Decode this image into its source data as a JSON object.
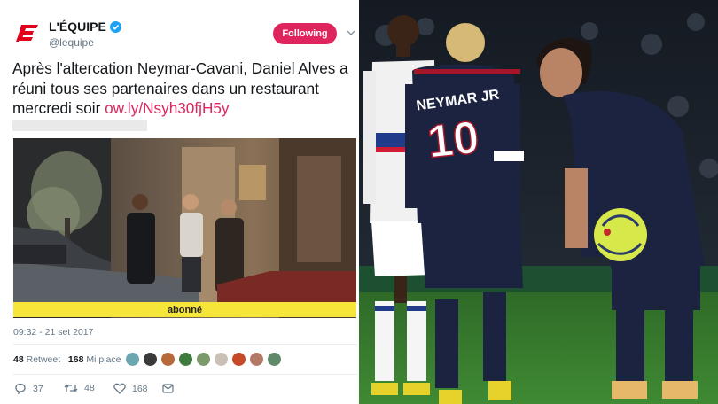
{
  "tweet": {
    "display_name": "L'ÉQUIPE",
    "handle": "@lequipe",
    "follow_label": "Following",
    "text": "Après l'altercation Neymar-Cavani, Daniel Alves a réuni tous ses partenaires dans un restaurant mercredi soir ",
    "link": "ow.ly/Nsyh30fjH5y",
    "media_caption": "abonné",
    "timestamp": "09:32 - 21 set 2017",
    "retweets": "48",
    "retweets_label": "Retweet",
    "likes": "168",
    "likes_label": "Mi piace",
    "reply_count": "37",
    "retweet_count": "48",
    "like_count": "168"
  },
  "photo": {
    "jersey_name": "NEYMAR JR",
    "jersey_number": "10"
  },
  "colors": {
    "brand_red": "#e0245e",
    "twitter_blue": "#1da1f2",
    "caption_yellow": "#f6e63a",
    "pitch_green": "#3f7a2e",
    "psg_navy": "#1c2340"
  },
  "icons": [
    "equipe-logo-icon",
    "verified-icon",
    "chevron-down-icon",
    "reply-icon",
    "retweet-icon",
    "like-icon",
    "message-icon"
  ]
}
